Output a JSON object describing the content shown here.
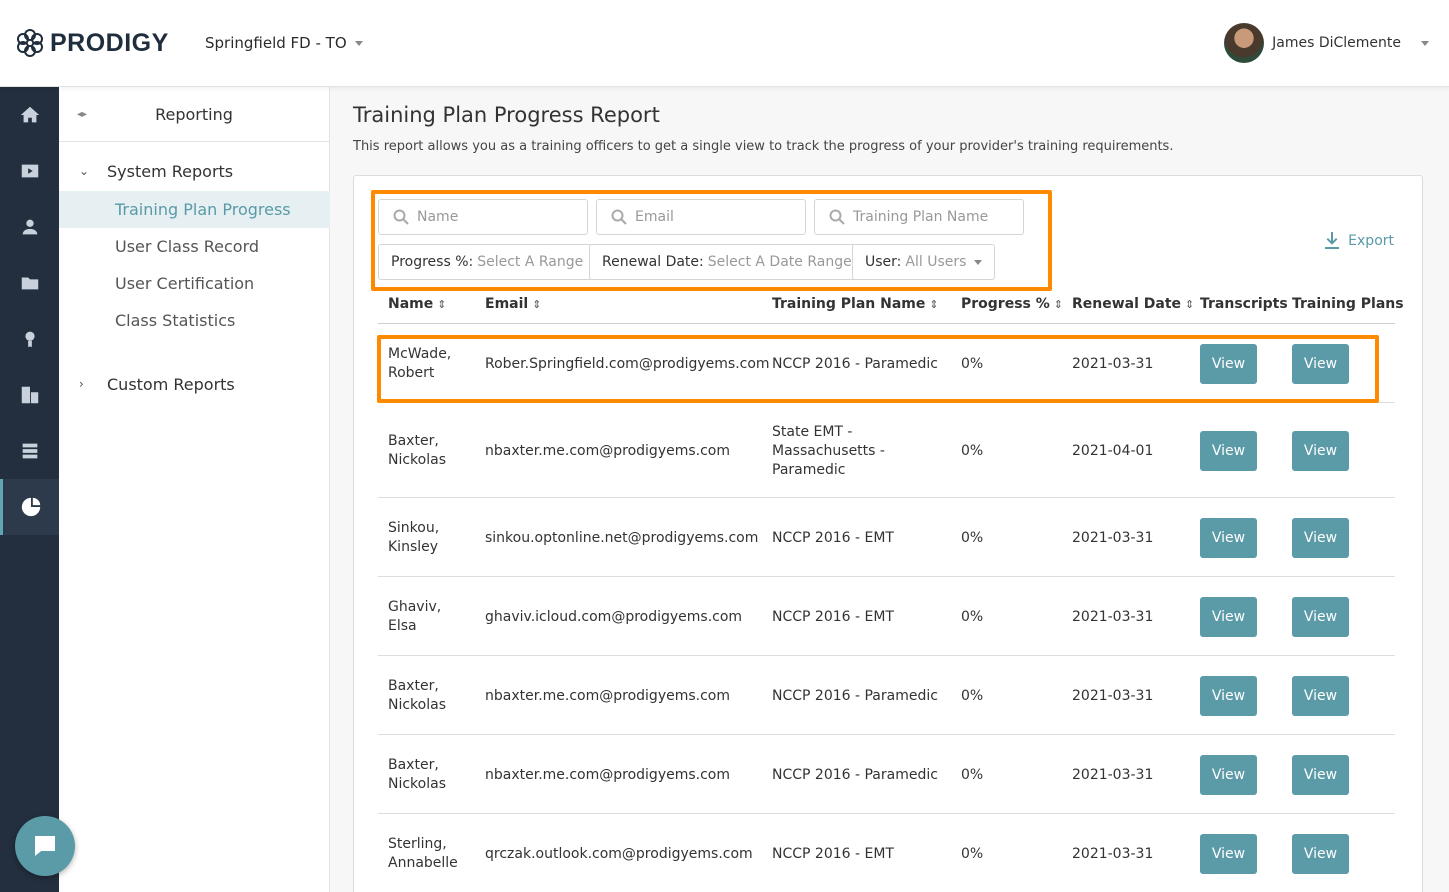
{
  "header": {
    "logo_text": "PRODIGY",
    "org_name": "Springfield FD - TO",
    "user_name": "James DiClemente"
  },
  "rail": [
    "home-icon",
    "video-icon",
    "users-icon",
    "folder-icon",
    "award-icon",
    "buildings-icon",
    "database-icon",
    "reports-icon"
  ],
  "subnav": {
    "title": "Reporting",
    "system_reports_label": "System Reports",
    "items": [
      "Training Plan Progress",
      "User Class Record",
      "User Certification",
      "Class Statistics"
    ],
    "custom_reports_label": "Custom Reports"
  },
  "page": {
    "title": "Training Plan Progress Report",
    "description": "This report allows you as a training officers to get a single view to track the progress of your provider's training requirements."
  },
  "filters": {
    "name_placeholder": "Name",
    "email_placeholder": "Email",
    "plan_placeholder": "Training Plan Name",
    "progress_label": "Progress %:",
    "progress_value": "Select A Range",
    "renewal_label": "Renewal Date:",
    "renewal_value": "Select A Date Range",
    "user_label": "User:",
    "user_value": "All Users",
    "export_label": "Export"
  },
  "table": {
    "columns": [
      "Name",
      "Email",
      "Training Plan Name",
      "Progress %",
      "Renewal Date",
      "Transcripts",
      "Training Plans"
    ],
    "view_label": "View",
    "rows": [
      {
        "name1": "McWade,",
        "name2": "Robert",
        "email": "Rober.Springfield.com@prodigyems.com",
        "plan1": "NCCP 2016 - Paramedic",
        "plan2": "",
        "plan3": "",
        "progress": "0%",
        "renewal": "2021-03-31"
      },
      {
        "name1": "Baxter,",
        "name2": "Nickolas",
        "email": "nbaxter.me.com@prodigyems.com",
        "plan1": "State EMT -",
        "plan2": "Massachusetts -",
        "plan3": "Paramedic",
        "progress": "0%",
        "renewal": "2021-04-01"
      },
      {
        "name1": "Sinkou,",
        "name2": "Kinsley",
        "email": "sinkou.optonline.net@prodigyems.com",
        "plan1": "NCCP 2016 - EMT",
        "plan2": "",
        "plan3": "",
        "progress": "0%",
        "renewal": "2021-03-31"
      },
      {
        "name1": "Ghaviv,",
        "name2": "Elsa",
        "email": "ghaviv.icloud.com@prodigyems.com",
        "plan1": "NCCP 2016 - EMT",
        "plan2": "",
        "plan3": "",
        "progress": "0%",
        "renewal": "2021-03-31"
      },
      {
        "name1": "Baxter,",
        "name2": "Nickolas",
        "email": "nbaxter.me.com@prodigyems.com",
        "plan1": "NCCP 2016 - Paramedic",
        "plan2": "",
        "plan3": "",
        "progress": "0%",
        "renewal": "2021-03-31"
      },
      {
        "name1": "Baxter,",
        "name2": "Nickolas",
        "email": "nbaxter.me.com@prodigyems.com",
        "plan1": "NCCP 2016 - Paramedic",
        "plan2": "",
        "plan3": "",
        "progress": "0%",
        "renewal": "2021-03-31"
      },
      {
        "name1": "Sterling,",
        "name2": "Annabelle",
        "email": "qrczak.outlook.com@prodigyems.com",
        "plan1": "NCCP 2016 - EMT",
        "plan2": "",
        "plan3": "",
        "progress": "0%",
        "renewal": "2021-03-31"
      }
    ]
  },
  "colors": {
    "accent": "#5b9ba8",
    "highlight": "#ff8a00",
    "rail_bg": "#232f3e"
  }
}
